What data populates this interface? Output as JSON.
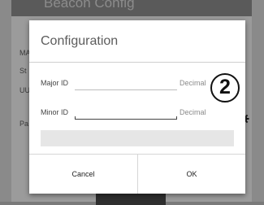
{
  "background_app": {
    "title": "Beacon Config",
    "labels": [
      "MA",
      "St",
      "UU",
      "Pa"
    ]
  },
  "dialog": {
    "title": "Configuration",
    "fields": [
      {
        "label": "Major ID",
        "value": "",
        "unit": "Decimal"
      },
      {
        "label": "Minor ID",
        "value": "",
        "unit": "Decimal"
      }
    ],
    "cancel_label": "Cancel",
    "ok_label": "OK"
  },
  "callout": {
    "number": "2"
  },
  "colors": {
    "scrim": "#7a7a7a",
    "dialog_bg": "#ffffff",
    "separator": "#cfcfcf"
  },
  "icons": [
    "gear-icon"
  ]
}
